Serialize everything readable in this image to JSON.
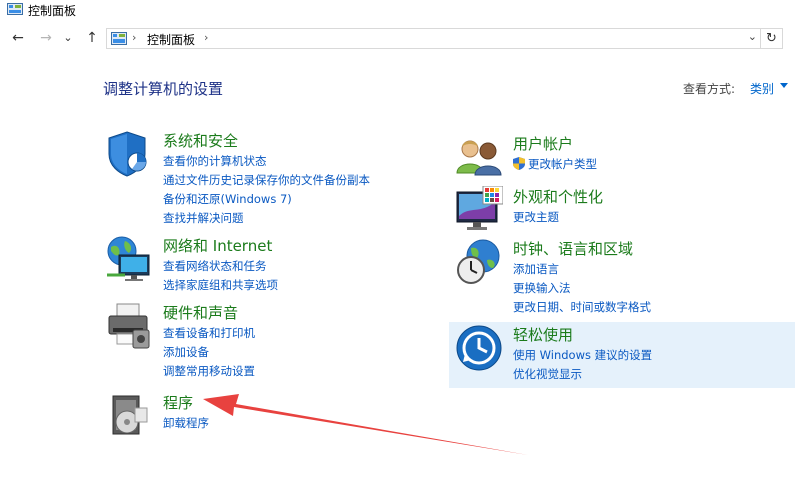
{
  "window": {
    "title": "控制面板"
  },
  "nav": {
    "back_glyph": "←",
    "forward_glyph": "→",
    "recent_glyph": "⌄",
    "up_glyph": "↑",
    "breadcrumb": "控制面板",
    "refresh_glyph": "↻"
  },
  "header": {
    "title": "调整计算机的设置",
    "view_by_label": "查看方式:",
    "view_by_value": "类别"
  },
  "categories": {
    "system": {
      "title": "系统和安全",
      "links": [
        "查看你的计算机状态",
        "通过文件历史记录保存你的文件备份副本",
        "备份和还原(Windows 7)",
        "查找并解决问题"
      ]
    },
    "network": {
      "title": "网络和 Internet",
      "links": [
        "查看网络状态和任务",
        "选择家庭组和共享选项"
      ]
    },
    "hardware": {
      "title": "硬件和声音",
      "links": [
        "查看设备和打印机",
        "添加设备",
        "调整常用移动设置"
      ]
    },
    "programs": {
      "title": "程序",
      "links": [
        "卸载程序"
      ]
    },
    "users": {
      "title": "用户帐户",
      "links": [
        "更改帐户类型"
      ]
    },
    "appearance": {
      "title": "外观和个性化",
      "links": [
        "更改主题"
      ]
    },
    "clock": {
      "title": "时钟、语言和区域",
      "links": [
        "添加语言",
        "更换输入法",
        "更改日期、时间或数字格式"
      ]
    },
    "ease": {
      "title": "轻松使用",
      "links": [
        "使用 Windows 建议的设置",
        "优化视觉显示"
      ]
    }
  },
  "colors": {
    "category_title": "#1b7b1b",
    "link": "#0a59c2",
    "page_title": "#1e3287",
    "highlight": "#e5f1fb",
    "annotation_arrow": "#e8423f"
  }
}
